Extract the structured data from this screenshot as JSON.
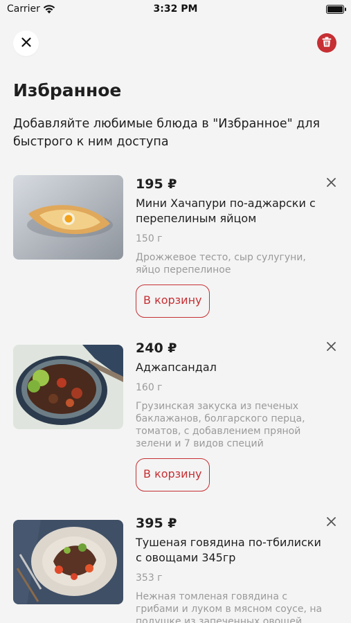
{
  "status_bar": {
    "carrier": "Carrier",
    "time": "3:32 PM"
  },
  "header": {
    "title": "Избранное",
    "subtitle": "Добавляйте любимые блюда в \"Избранное\" для быстрого к ним доступа"
  },
  "colors": {
    "accent": "#c62f33",
    "muted": "#9a9a9a",
    "background": "#f4f4f4"
  },
  "icons": {
    "close": "close-icon",
    "trash": "trash-icon",
    "remove": "x-icon"
  },
  "items": [
    {
      "price": "195 ₽",
      "name": "Мини Хачапури по-аджарски с перепелиным яйцом",
      "weight": "150 г",
      "description": "Дрожжевое тесто, сыр сулугуни, яйцо перепелиное",
      "cart_label": "В корзину"
    },
    {
      "price": "240 ₽",
      "name": "Аджапсандал",
      "weight": "160 г",
      "description": "Грузинская закуска из печеных баклажанов, болгарского перца, томатов, с добавлением пряной зелени и 7 видов специй",
      "cart_label": "В корзину"
    },
    {
      "price": "395 ₽",
      "name": "Тушеная говядина по-тбилиски с овощами 345гр",
      "weight": "353 г",
      "description": "Нежная томленая говядина с грибами и луком в мясном соусе, на подушке из запеченных овощей"
    }
  ]
}
